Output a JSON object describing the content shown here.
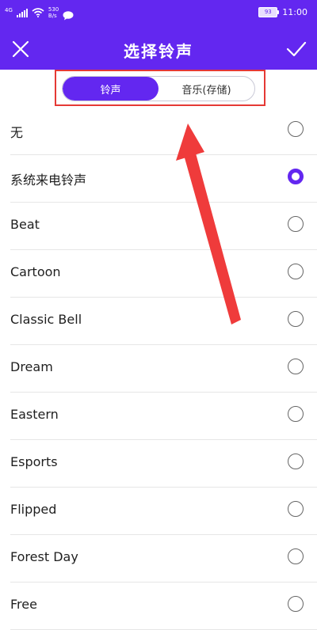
{
  "status_bar": {
    "network": "4G",
    "speed": "530",
    "speed_unit": "B/s",
    "battery": "93",
    "time": "11:00"
  },
  "app_bar": {
    "title": "选择铃声",
    "close_icon": "close-icon",
    "confirm_icon": "check-icon"
  },
  "tabs": [
    {
      "label": "铃声",
      "active": true
    },
    {
      "label": "音乐(存储)",
      "active": false
    }
  ],
  "ringtones": [
    {
      "label": "无",
      "selected": false
    },
    {
      "label": "系统来电铃声",
      "selected": true
    },
    {
      "label": "Beat",
      "selected": false
    },
    {
      "label": "Cartoon",
      "selected": false
    },
    {
      "label": "Classic Bell",
      "selected": false
    },
    {
      "label": "Dream",
      "selected": false
    },
    {
      "label": "Eastern",
      "selected": false
    },
    {
      "label": "Esports",
      "selected": false
    },
    {
      "label": "Flipped",
      "selected": false
    },
    {
      "label": "Forest Day",
      "selected": false
    },
    {
      "label": "Free",
      "selected": false
    }
  ],
  "colors": {
    "accent": "#6327f0",
    "annotation": "#e53935"
  }
}
